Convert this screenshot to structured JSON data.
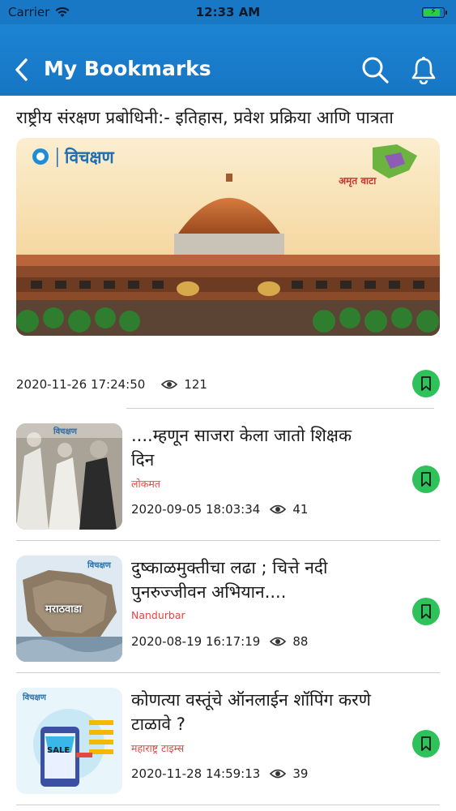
{
  "status_bar": {
    "carrier": "Carrier",
    "time": "12:33 AM",
    "battery_level": 0.85
  },
  "nav": {
    "title": "My Bookmarks"
  },
  "colors": {
    "header": "#1878c6",
    "accent_green": "#2fc25a",
    "source_red": "#e0463f"
  },
  "featured": {
    "title": "राष्ट्रीय संरक्षण प्रबोधिनी:- इतिहास, प्रवेश प्रक्रिया आणि पात्रता",
    "timestamp": "2020-11-26 17:24:50",
    "views": "121",
    "banner_brand": "विचक्षण",
    "banner_tagline": "अमृत वाटा"
  },
  "items": [
    {
      "title": "....म्हणून साजरा केला जातो शिक्षक दिन",
      "source": "लोकमत",
      "timestamp": "2020-09-05 18:03:34",
      "views": "41",
      "thumb_brand": "विचक्षण"
    },
    {
      "title": "दुष्काळमुक्तीचा लढा ; चित्ते नदी पुनरुज्जीवन अभियान....",
      "source": "Nandurbar",
      "timestamp": "2020-08-19 16:17:19",
      "views": "88",
      "thumb_brand": "विचक्षण",
      "thumb_label": "मराठवाडा"
    },
    {
      "title": "कोणत्या वस्तूंचे ऑनलाईन शॉपिंग करणे टाळावे ?",
      "source": "महाराष्ट्र टाइम्स",
      "timestamp": "2020-11-28 14:59:13",
      "views": "39",
      "thumb_brand": "विचक्षण",
      "thumb_label": "SALE"
    }
  ],
  "icons": [
    "chevron-left-icon",
    "search-icon",
    "bell-icon",
    "eye-icon",
    "bookmark-icon",
    "wifi-icon",
    "battery-icon"
  ]
}
